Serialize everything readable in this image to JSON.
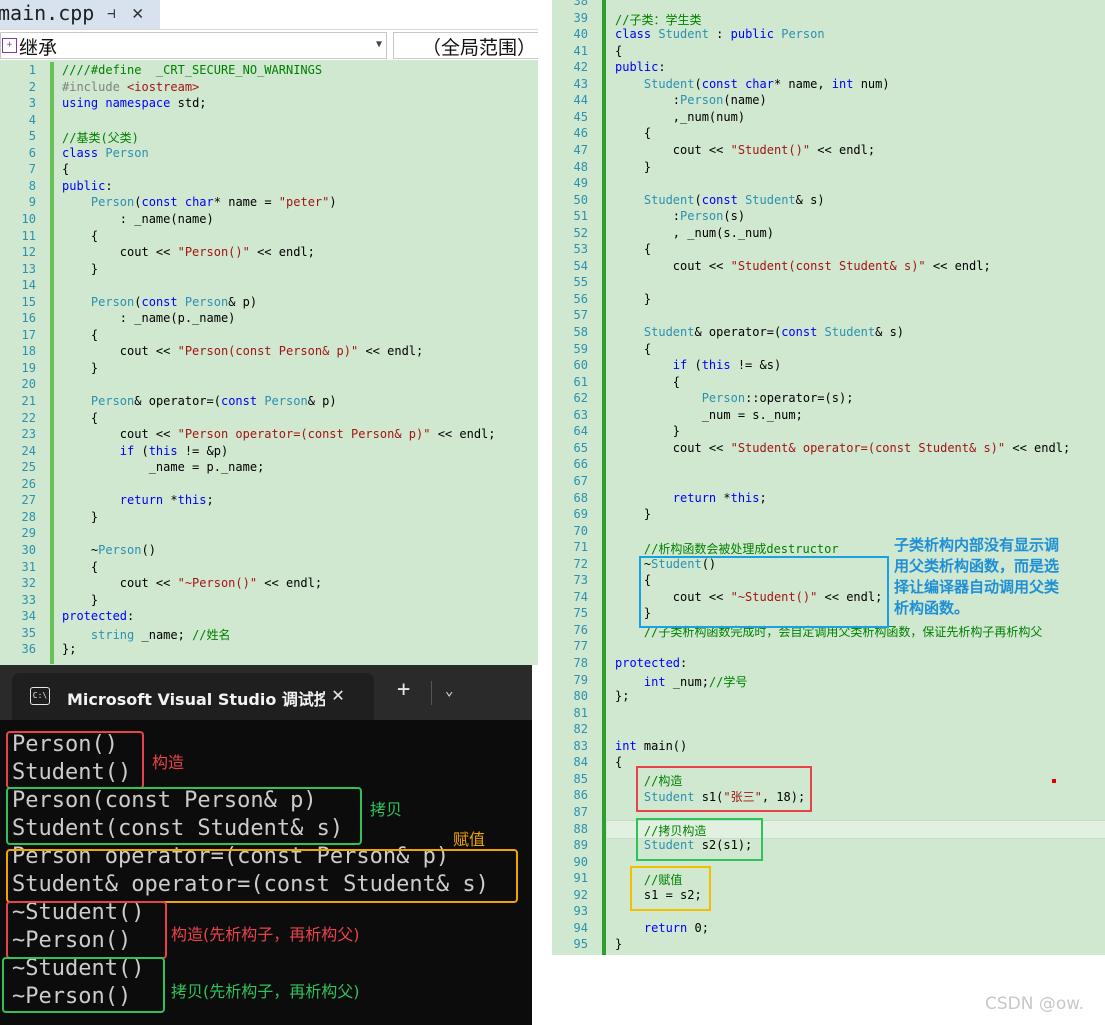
{
  "editor": {
    "file_tab": {
      "label": "main.cpp",
      "pin_icon": "pin-icon",
      "close_icon": "close-icon"
    },
    "nav": {
      "scope_left": "继承",
      "scope_right": "（全局范围）"
    },
    "left_code": [
      {
        "n": "1",
        "t": "////#define  _CRT_SECURE_NO_WARNINGS",
        "c": "cm"
      },
      {
        "n": "2",
        "t": "#include <iostream>",
        "c": "pp"
      },
      {
        "n": "3",
        "t": "using namespace std;",
        "c": "kw"
      },
      {
        "n": "4",
        "t": "",
        "c": ""
      },
      {
        "n": "5",
        "t": "//基类(父类)",
        "c": "cm"
      },
      {
        "n": "6",
        "t": "class Person",
        "c": "kw"
      },
      {
        "n": "7",
        "t": "{",
        "c": ""
      },
      {
        "n": "8",
        "t": "public:",
        "c": "kw"
      },
      {
        "n": "9",
        "t": "    Person(const char* name = \"peter\")",
        "c": ""
      },
      {
        "n": "10",
        "t": "        : _name(name)",
        "c": ""
      },
      {
        "n": "11",
        "t": "    {",
        "c": ""
      },
      {
        "n": "12",
        "t": "        cout << \"Person()\" << endl;",
        "c": ""
      },
      {
        "n": "13",
        "t": "    }",
        "c": ""
      },
      {
        "n": "14",
        "t": "",
        "c": ""
      },
      {
        "n": "15",
        "t": "    Person(const Person& p)",
        "c": ""
      },
      {
        "n": "16",
        "t": "        : _name(p._name)",
        "c": ""
      },
      {
        "n": "17",
        "t": "    {",
        "c": ""
      },
      {
        "n": "18",
        "t": "        cout << \"Person(const Person& p)\" << endl;",
        "c": ""
      },
      {
        "n": "19",
        "t": "    }",
        "c": ""
      },
      {
        "n": "20",
        "t": "",
        "c": ""
      },
      {
        "n": "21",
        "t": "    Person& operator=(const Person& p)",
        "c": ""
      },
      {
        "n": "22",
        "t": "    {",
        "c": ""
      },
      {
        "n": "23",
        "t": "        cout << \"Person operator=(const Person& p)\" << endl;",
        "c": ""
      },
      {
        "n": "24",
        "t": "        if (this != &p)",
        "c": ""
      },
      {
        "n": "25",
        "t": "            _name = p._name;",
        "c": ""
      },
      {
        "n": "26",
        "t": "",
        "c": ""
      },
      {
        "n": "27",
        "t": "        return *this;",
        "c": ""
      },
      {
        "n": "28",
        "t": "    }",
        "c": ""
      },
      {
        "n": "29",
        "t": "",
        "c": ""
      },
      {
        "n": "30",
        "t": "    ~Person()",
        "c": ""
      },
      {
        "n": "31",
        "t": "    {",
        "c": ""
      },
      {
        "n": "32",
        "t": "        cout << \"~Person()\" << endl;",
        "c": ""
      },
      {
        "n": "33",
        "t": "    }",
        "c": ""
      },
      {
        "n": "34",
        "t": "protected:",
        "c": "kw"
      },
      {
        "n": "35",
        "t": "    string _name; //姓名",
        "c": ""
      },
      {
        "n": "36",
        "t": "};",
        "c": ""
      }
    ],
    "right_code": [
      {
        "n": "38",
        "t": ""
      },
      {
        "n": "39",
        "t": "//子类：学生类"
      },
      {
        "n": "40",
        "t": "class Student : public Person"
      },
      {
        "n": "41",
        "t": "{"
      },
      {
        "n": "42",
        "t": "public:"
      },
      {
        "n": "43",
        "t": "    Student(const char* name, int num)"
      },
      {
        "n": "44",
        "t": "        :Person(name)"
      },
      {
        "n": "45",
        "t": "        ,_num(num)"
      },
      {
        "n": "46",
        "t": "    {"
      },
      {
        "n": "47",
        "t": "        cout << \"Student()\" << endl;"
      },
      {
        "n": "48",
        "t": "    }"
      },
      {
        "n": "49",
        "t": ""
      },
      {
        "n": "50",
        "t": "    Student(const Student& s)"
      },
      {
        "n": "51",
        "t": "        :Person(s)"
      },
      {
        "n": "52",
        "t": "        , _num(s._num)"
      },
      {
        "n": "53",
        "t": "    {"
      },
      {
        "n": "54",
        "t": "        cout << \"Student(const Student& s)\" << endl;"
      },
      {
        "n": "55",
        "t": ""
      },
      {
        "n": "56",
        "t": "    }"
      },
      {
        "n": "57",
        "t": ""
      },
      {
        "n": "58",
        "t": "    Student& operator=(const Student& s)"
      },
      {
        "n": "59",
        "t": "    {"
      },
      {
        "n": "60",
        "t": "        if (this != &s)"
      },
      {
        "n": "61",
        "t": "        {"
      },
      {
        "n": "62",
        "t": "            Person::operator=(s);"
      },
      {
        "n": "63",
        "t": "            _num = s._num;"
      },
      {
        "n": "64",
        "t": "        }"
      },
      {
        "n": "65",
        "t": "        cout << \"Student& operator=(const Student& s)\" << endl;"
      },
      {
        "n": "66",
        "t": ""
      },
      {
        "n": "67",
        "t": ""
      },
      {
        "n": "68",
        "t": "        return *this;"
      },
      {
        "n": "69",
        "t": "    }"
      },
      {
        "n": "70",
        "t": ""
      },
      {
        "n": "71",
        "t": "    //析构函数会被处理成destructor"
      },
      {
        "n": "72",
        "t": "    ~Student()"
      },
      {
        "n": "73",
        "t": "    {"
      },
      {
        "n": "74",
        "t": "        cout << \"~Student()\" << endl;"
      },
      {
        "n": "75",
        "t": "    }"
      },
      {
        "n": "76",
        "t": "    //子类析构函数完成时，会自定调用父类析构函数，保证先析构子再析构父"
      },
      {
        "n": "77",
        "t": ""
      },
      {
        "n": "78",
        "t": "protected:"
      },
      {
        "n": "79",
        "t": "    int _num;//学号"
      },
      {
        "n": "80",
        "t": "};"
      },
      {
        "n": "81",
        "t": ""
      },
      {
        "n": "82",
        "t": ""
      },
      {
        "n": "83",
        "t": "int main()"
      },
      {
        "n": "84",
        "t": "{"
      },
      {
        "n": "85",
        "t": "    //构造"
      },
      {
        "n": "86",
        "t": "    Student s1(\"张三\", 18);"
      },
      {
        "n": "87",
        "t": ""
      },
      {
        "n": "88",
        "t": "    //拷贝构造"
      },
      {
        "n": "89",
        "t": "    Student s2(s1);"
      },
      {
        "n": "90",
        "t": ""
      },
      {
        "n": "91",
        "t": "    //赋值"
      },
      {
        "n": "92",
        "t": "    s1 = s2;"
      },
      {
        "n": "93",
        "t": ""
      },
      {
        "n": "94",
        "t": "    return 0;"
      },
      {
        "n": "95",
        "t": "}"
      }
    ],
    "destructor_note": [
      "子类析构内部没有显示调",
      "用父类析构函数，而是选",
      "择让编译器自动调用父类",
      "析构函数。"
    ]
  },
  "terminal": {
    "title": "Microsoft Visual Studio 调试控制台",
    "new_tab_icon": "plus-icon",
    "dropdown_icon": "chevron-down-icon",
    "lines": [
      "Person()",
      "Student()",
      "Person(const Person& p)",
      "Student(const Student& s)",
      "Person operator=(const Person& p)",
      "Student& operator=(const Student& s)",
      "~Student()",
      "~Person()",
      "~Student()",
      "~Person()"
    ],
    "notes": {
      "construct": "构造",
      "copy": "拷贝",
      "assign": "赋值",
      "destruct_construct": "构造(先析构子，再析构父)",
      "destruct_copy": "拷贝(先析构子，再析构父)"
    }
  },
  "colors": {
    "red": "#e8434b",
    "green": "#2fc25b",
    "orange": "#f0a400",
    "blue": "#1aa2e0"
  },
  "watermark": "CSDN @ow."
}
